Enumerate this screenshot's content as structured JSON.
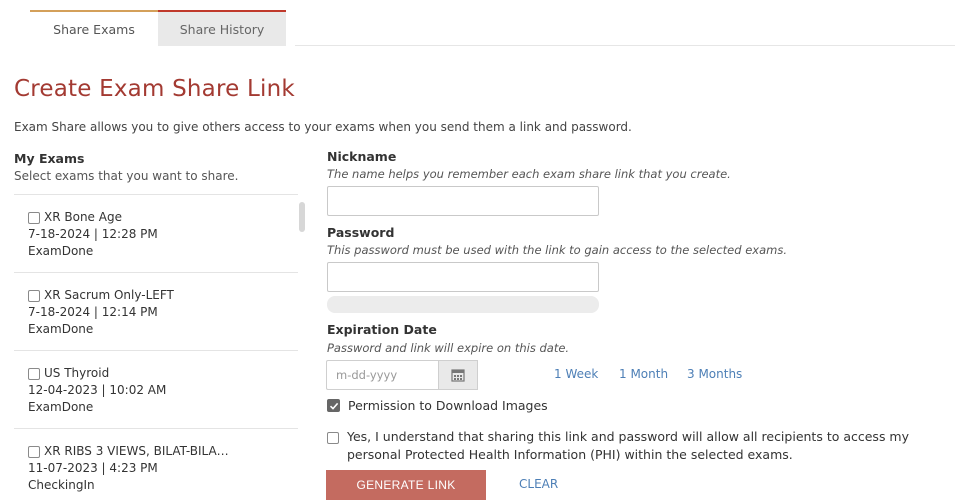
{
  "tabs": [
    {
      "label": "Share Exams",
      "active": true
    },
    {
      "label": "Share History",
      "active": false
    }
  ],
  "title": "Create Exam Share Link",
  "intro": "Exam Share allows you to give others access to your exams when you send them a link and password.",
  "my_exams": {
    "heading": "My Exams",
    "subheading": "Select exams that you want to share.",
    "items": [
      {
        "name": "XR Bone Age",
        "datetime": "7-18-2024 | 12:28 PM",
        "status": "ExamDone",
        "checked": false
      },
      {
        "name": "XR Sacrum Only-LEFT",
        "datetime": "7-18-2024 | 12:14 PM",
        "status": "ExamDone",
        "checked": false
      },
      {
        "name": "US Thyroid",
        "datetime": "12-04-2023 | 10:02 AM",
        "status": "ExamDone",
        "checked": false
      },
      {
        "name": "XR RIBS 3 VIEWS, BILAT-BILA…",
        "datetime": "11-07-2023 | 4:23 PM",
        "status": "CheckingIn",
        "checked": false
      }
    ]
  },
  "nickname": {
    "label": "Nickname",
    "help": "The name helps you remember each exam share link that you create.",
    "value": ""
  },
  "password": {
    "label": "Password",
    "help": "This password must be used with the link to gain access to the selected exams.",
    "value": ""
  },
  "expiration": {
    "label": "Expiration Date",
    "help": "Password and link will expire on this date.",
    "placeholder": "m-dd-yyyy",
    "icon": "calendar-icon",
    "quick_options": [
      "1 Week",
      "1 Month",
      "3 Months"
    ]
  },
  "permission": {
    "label": "Permission to Download Images",
    "checked": true
  },
  "consent": {
    "label": "Yes, I understand that sharing this link and password will allow all recipients to access my personal Protected Health Information (PHI) within the selected exams.",
    "checked": false
  },
  "actions": {
    "generate": "GENERATE LINK",
    "clear": "CLEAR"
  },
  "colors": {
    "title": "#a33a32",
    "button": "#c46b60",
    "link": "#4d7fb6",
    "active_tab_accent": "#d4a05a"
  }
}
